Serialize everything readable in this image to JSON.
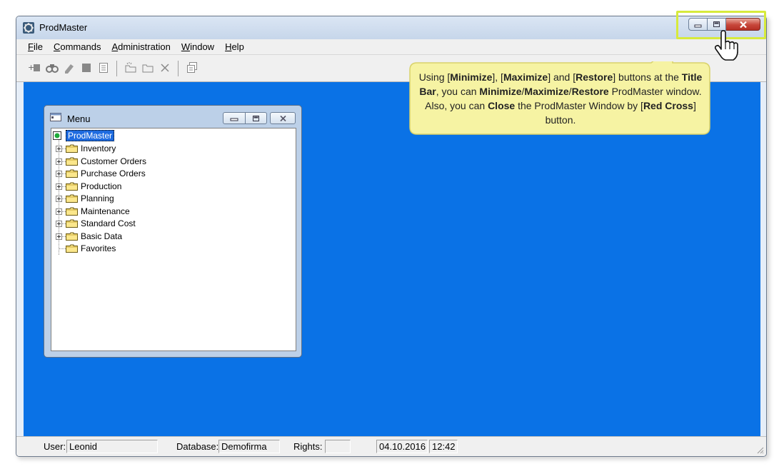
{
  "window": {
    "title": "ProdMaster"
  },
  "menubar": {
    "items": [
      {
        "name": "file",
        "label": "File",
        "accel": "F",
        "rest": "ile"
      },
      {
        "name": "commands",
        "label": "Commands",
        "accel": "C",
        "rest": "ommands"
      },
      {
        "name": "administration",
        "label": "Administration",
        "accel": "A",
        "rest": "dministration"
      },
      {
        "name": "window",
        "label": "Window",
        "accel": "W",
        "rest": "indow"
      },
      {
        "name": "help",
        "label": "Help",
        "accel": "H",
        "rest": "elp"
      }
    ]
  },
  "toolbar": {
    "icons": [
      "add-record-icon",
      "find-icon",
      "edit-icon",
      "stop-icon",
      "document-icon",
      "new-folder-icon",
      "open-folder-icon",
      "delete-icon",
      "copy-icon"
    ]
  },
  "menu_window": {
    "title": "Menu",
    "root": "ProdMaster",
    "items": [
      {
        "label": "Inventory",
        "expandable": true
      },
      {
        "label": "Customer Orders",
        "expandable": true
      },
      {
        "label": "Purchase Orders",
        "expandable": true
      },
      {
        "label": "Production",
        "expandable": true
      },
      {
        "label": "Planning",
        "expandable": true
      },
      {
        "label": "Maintenance",
        "expandable": true
      },
      {
        "label": "Standard Cost",
        "expandable": true
      },
      {
        "label": "Basic Data",
        "expandable": true
      },
      {
        "label": "Favorites",
        "expandable": false
      }
    ]
  },
  "callout": {
    "parts": [
      {
        "t": "Using [",
        "b": false
      },
      {
        "t": "Minimize",
        "b": true
      },
      {
        "t": "], [",
        "b": false
      },
      {
        "t": "Maximize",
        "b": true
      },
      {
        "t": "] and [",
        "b": false
      },
      {
        "t": "Restore",
        "b": true
      },
      {
        "t": "] buttons at the ",
        "b": false
      },
      {
        "t": "Title Bar",
        "b": true
      },
      {
        "t": ", you can ",
        "b": false
      },
      {
        "t": "Minimize",
        "b": true
      },
      {
        "t": "/",
        "b": false
      },
      {
        "t": "Maximize",
        "b": true
      },
      {
        "t": "/",
        "b": false
      },
      {
        "t": "Restore",
        "b": true
      },
      {
        "t": " ProdMaster window.  Also, you can ",
        "b": false
      },
      {
        "t": "Close",
        "b": true
      },
      {
        "t": " the ProdMaster Window by [",
        "b": false
      },
      {
        "t": "Red Cross",
        "b": true
      },
      {
        "t": "] button.",
        "b": false
      }
    ]
  },
  "statusbar": {
    "user_label": "User:",
    "user": "Leonid",
    "database_label": "Database:",
    "database": "Demofirma",
    "rights_label": "Rights:",
    "rights": "",
    "date": "04.10.2016",
    "time": "12:42"
  },
  "colors": {
    "workspace": "#0a72e6",
    "callout_fill": "#f6f3a3",
    "highlight": "#d7ea3c",
    "close_button": "#c7463a"
  }
}
